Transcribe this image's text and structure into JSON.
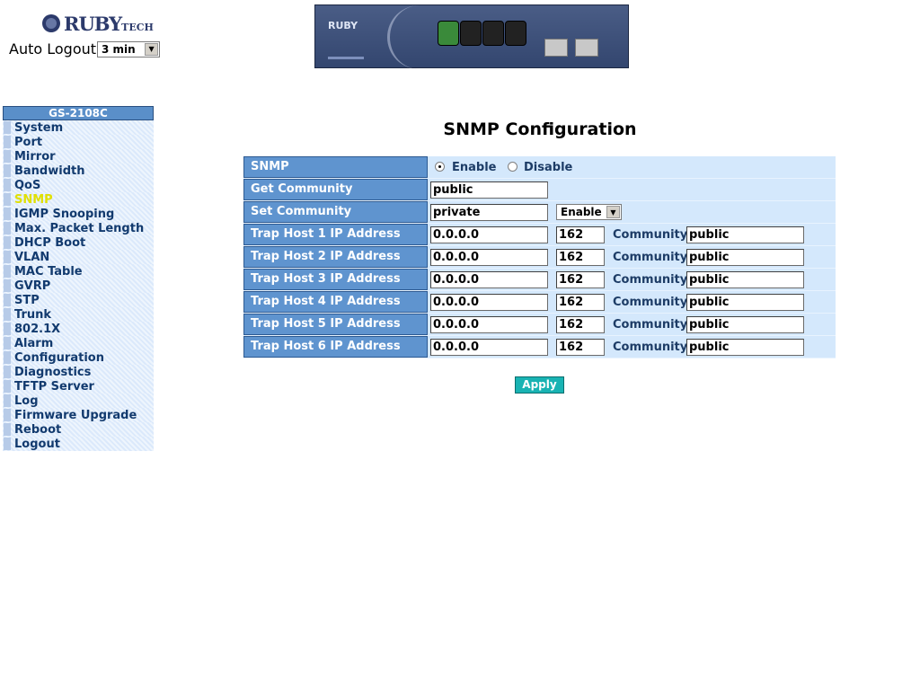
{
  "header": {
    "logo_text": "RUBY",
    "logo_sub": "TECH",
    "device_brand": "RUBY",
    "auto_logout_label": "Auto Logout",
    "auto_logout_value": "3 min"
  },
  "sidebar": {
    "title": "GS-2108C",
    "items": [
      {
        "label": "System",
        "active": false
      },
      {
        "label": "Port",
        "active": false
      },
      {
        "label": "Mirror",
        "active": false
      },
      {
        "label": "Bandwidth",
        "active": false
      },
      {
        "label": "QoS",
        "active": false
      },
      {
        "label": "SNMP",
        "active": true
      },
      {
        "label": "IGMP Snooping",
        "active": false
      },
      {
        "label": "Max. Packet Length",
        "active": false
      },
      {
        "label": "DHCP Boot",
        "active": false
      },
      {
        "label": "VLAN",
        "active": false
      },
      {
        "label": "MAC Table",
        "active": false
      },
      {
        "label": "GVRP",
        "active": false
      },
      {
        "label": "STP",
        "active": false
      },
      {
        "label": "Trunk",
        "active": false
      },
      {
        "label": "802.1X",
        "active": false
      },
      {
        "label": "Alarm",
        "active": false
      },
      {
        "label": "Configuration",
        "active": false
      },
      {
        "label": "Diagnostics",
        "active": false
      },
      {
        "label": "TFTP Server",
        "active": false
      },
      {
        "label": "Log",
        "active": false
      },
      {
        "label": "Firmware Upgrade",
        "active": false
      },
      {
        "label": "Reboot",
        "active": false
      },
      {
        "label": "Logout",
        "active": false
      }
    ]
  },
  "main": {
    "title": "SNMP Configuration",
    "snmp": {
      "label": "SNMP",
      "enable_label": "Enable",
      "disable_label": "Disable",
      "selected": "enable"
    },
    "get_community": {
      "label": "Get Community",
      "value": "public"
    },
    "set_community": {
      "label": "Set Community",
      "value": "private",
      "state": "Enable"
    },
    "community_label": "Community",
    "trap_hosts": [
      {
        "label": "Trap Host 1 IP Address",
        "ip": "0.0.0.0",
        "port": "162",
        "community": "public"
      },
      {
        "label": "Trap Host 2 IP Address",
        "ip": "0.0.0.0",
        "port": "162",
        "community": "public"
      },
      {
        "label": "Trap Host 3 IP Address",
        "ip": "0.0.0.0",
        "port": "162",
        "community": "public"
      },
      {
        "label": "Trap Host 4 IP Address",
        "ip": "0.0.0.0",
        "port": "162",
        "community": "public"
      },
      {
        "label": "Trap Host 5 IP Address",
        "ip": "0.0.0.0",
        "port": "162",
        "community": "public"
      },
      {
        "label": "Trap Host 6 IP Address",
        "ip": "0.0.0.0",
        "port": "162",
        "community": "public"
      }
    ],
    "apply_label": "Apply"
  },
  "colors": {
    "label_bg": "#5f94cf",
    "row_bg": "#d4e8fc",
    "apply_bg": "#19b3b3",
    "active_menu": "#e0e000"
  }
}
